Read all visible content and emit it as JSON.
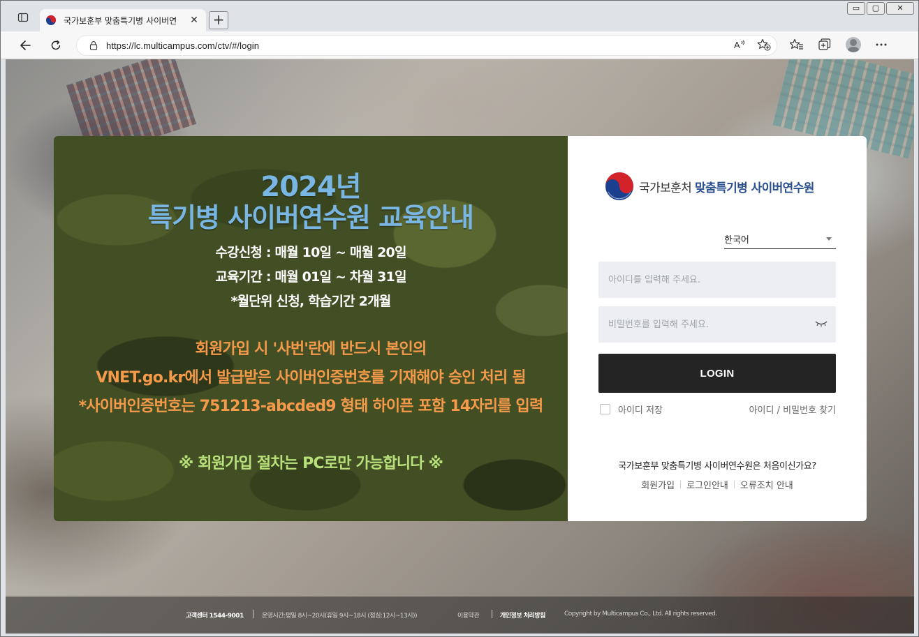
{
  "browser": {
    "tab_title": "국가보훈부 맞춤특기병 사이버연",
    "tab_close": "✕",
    "new_tab": "+",
    "url": "https://lc.multicampus.com/ctv/#/login",
    "window_controls": {
      "minimize": "▭",
      "maximize": "▢",
      "close": "✕"
    }
  },
  "promo": {
    "title_line1": "2024년",
    "title_line2": "특기병 사이버연수원 교육안내",
    "info": [
      "수강신청 : 매월 10일 ~ 매월 20일",
      "교육기간 : 매월 01일 ~ 차월 31일",
      "*월단위 신청, 학습기간 2개월"
    ],
    "notice": [
      "회원가입 시 '사번'란에 반드시 본인의",
      "VNET.go.kr에서 발급받은 사이버인증번호를 기재해야 승인 처리 됨",
      "*사이버인증번호는 751213-abcded9 형태 하이픈 포함 14자리를 입력"
    ],
    "pc_only": "※ 회원가입 절차는 PC로만 가능합니다 ※"
  },
  "login": {
    "logo_text_prefix": "국가보훈처",
    "logo_text_accent": "맞춤특기병 사이버연수원",
    "language": "한국어",
    "id_placeholder": "아이디를 입력해 주세요.",
    "pw_placeholder": "비밀번호를 입력해 주세요.",
    "login_button": "LOGIN",
    "remember_label": "아이디 저장",
    "find_link": "아이디 / 비밀번호 찾기",
    "first_visit": "국가보훈부 맞춤특기병 사이버연수원은 처음이신가요?",
    "links": [
      "회원가입",
      "로그인안내",
      "오류조치 안내"
    ]
  },
  "footer": {
    "cs_label": "고객센터",
    "cs_phone": "1544-9001",
    "hours": "운영시간:평일 8시~20시(휴일 9시~18시 (점심:12시~13시))",
    "terms": "이용약관",
    "privacy": "개인정보 처리방침",
    "copyright": "Copyright by Multicampus Co., Ltd. All rights reserved."
  },
  "colors": {
    "promo_title": "#79b6e4",
    "promo_notice": "#f59a4a",
    "promo_pc_only": "#b8e07a",
    "login_button": "#242424",
    "logo_accent": "#2a4f8f"
  }
}
